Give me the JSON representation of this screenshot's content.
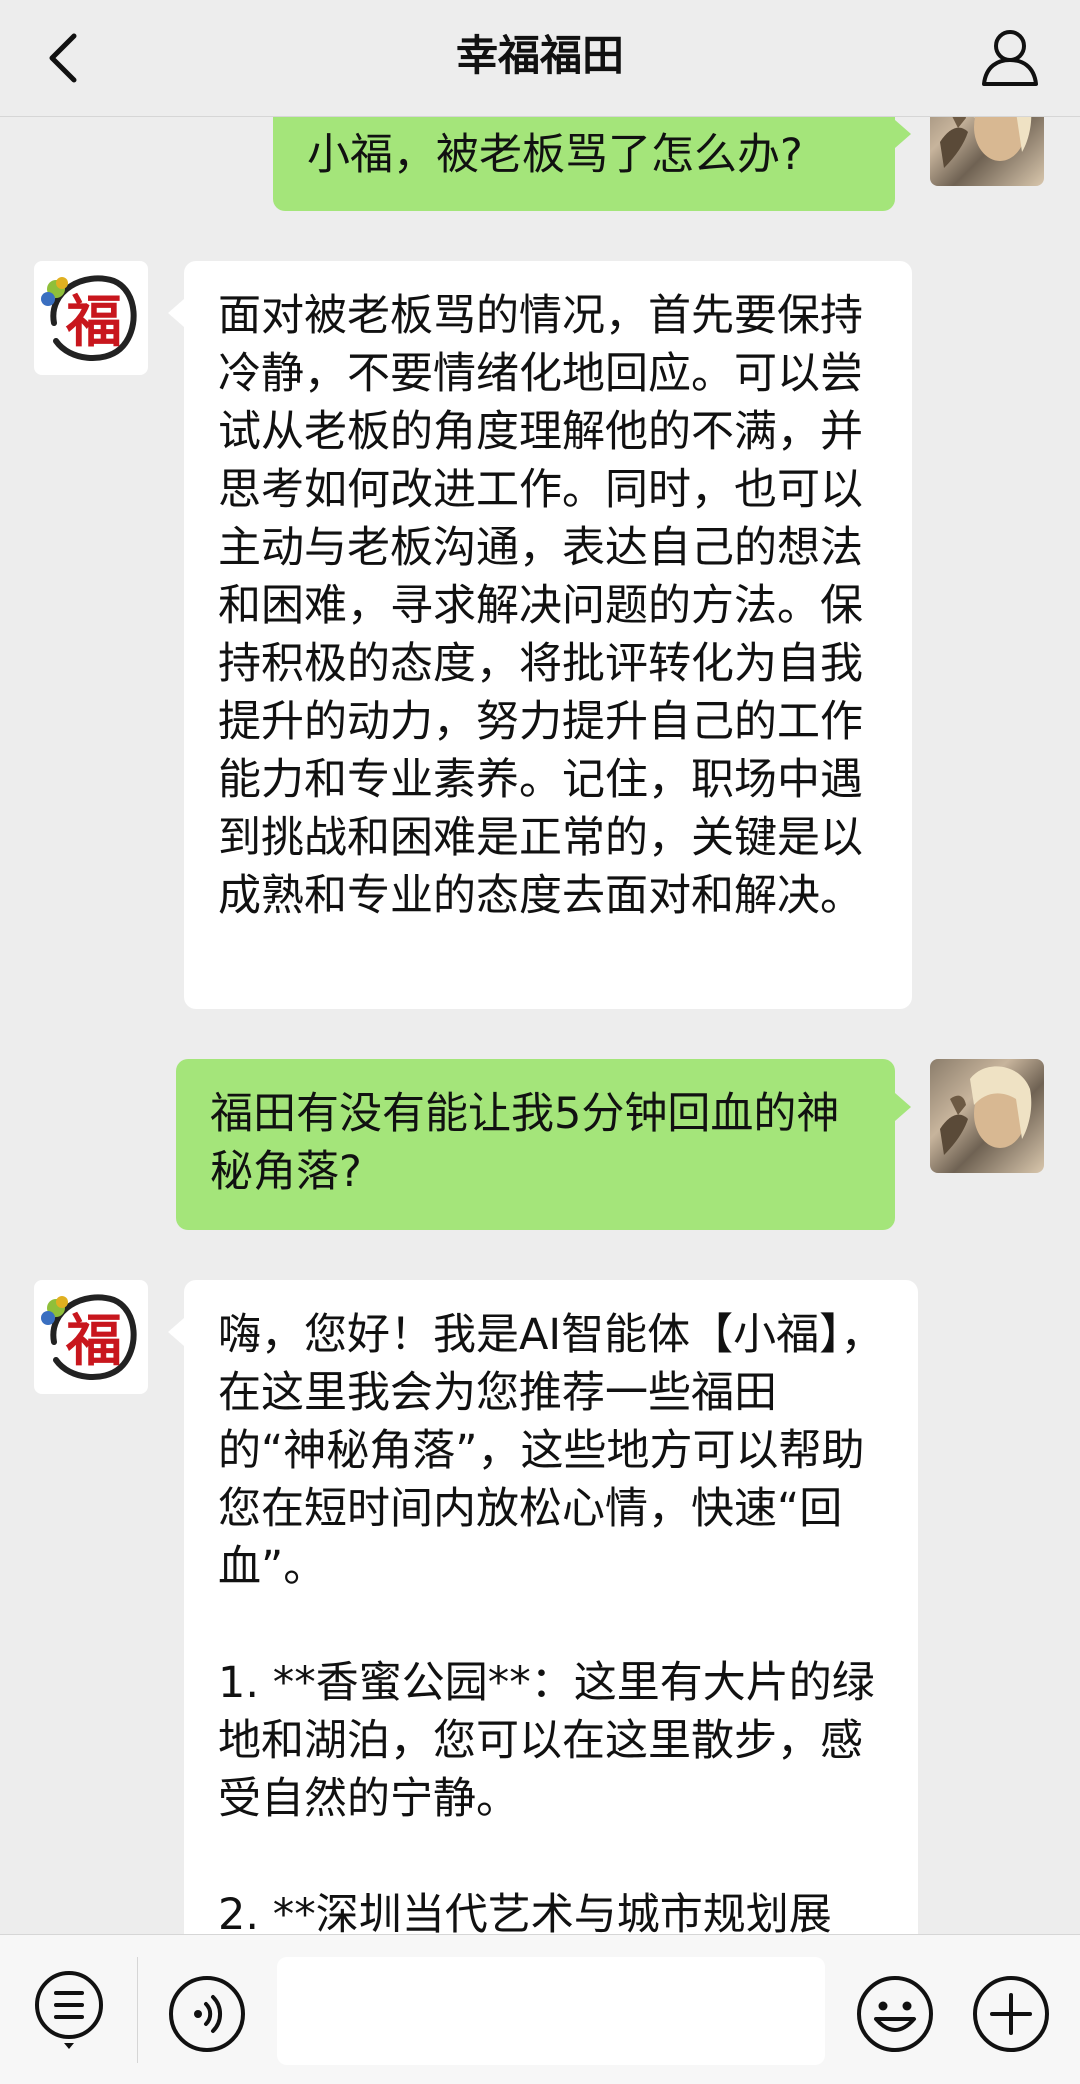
{
  "header": {
    "title": "幸福福田",
    "back_icon": "chevron-left-icon",
    "profile_icon": "user-icon"
  },
  "messages": [
    {
      "sender": "me",
      "text": "小福，被老板骂了怎么办?"
    },
    {
      "sender": "bot",
      "text": "面对被老板骂的情况，首先要保持冷静，不要情绪化地回应。可以尝试从老板的角度理解他的不满，并思考如何改进工作。同时，也可以主动与老板沟通，表达自己的想法和困难，寻求解决问题的方法。保持积极的态度，将批评转化为自我提升的动力，努力提升自己的工作能力和专业素养。记住，职场中遇到挑战和困难是正常的，关键是以成熟和专业的态度去面对和解决。"
    },
    {
      "sender": "me",
      "text": "福田有没有能让我5分钟回血的神秘角落?"
    },
    {
      "sender": "bot",
      "text": "嗨，您好！我是AI智能体【小福】，在这里我会为您推荐一些福田的“神秘角落”，这些地方可以帮助您在短时间内放松心情，快速“回血”。\n\n1. **香蜜公园**：这里有大片的绿地和湖泊，您可以在这里散步，感受自然的宁静。\n\n2. **深圳当代艺术与城市规划展"
    }
  ],
  "bot_avatar": {
    "glyph": "福"
  },
  "bottom_bar": {
    "menu_icon": "menu-list-icon",
    "voice_icon": "voice-icon",
    "input_value": "",
    "emoji_icon": "emoji-icon",
    "plus_icon": "plus-icon"
  },
  "colors": {
    "background": "#ededed",
    "my_bubble": "#a4e57a",
    "bot_bubble": "#ffffff",
    "logo_red": "#c8161d"
  }
}
